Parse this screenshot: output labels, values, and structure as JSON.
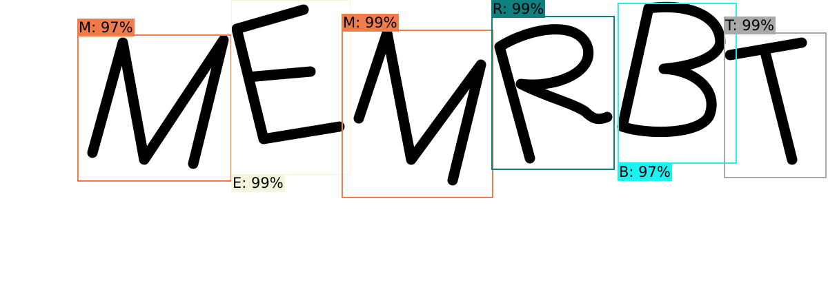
{
  "detections": [
    {
      "id": "m1",
      "letter": "M",
      "label": "M: 97%",
      "color": "#f07c4c",
      "label_text_color": "#000000"
    },
    {
      "id": "e",
      "letter": "E",
      "label": "E: 99%",
      "color": "#f5f5dc",
      "label_text_color": "#000000"
    },
    {
      "id": "m2",
      "letter": "M",
      "label": "M: 99%",
      "color": "#f07c4c",
      "label_text_color": "#000000"
    },
    {
      "id": "r",
      "letter": "R",
      "label": "R: 99%",
      "color": "#0f8080",
      "label_text_color": "#000000"
    },
    {
      "id": "b",
      "letter": "B",
      "label": "B: 97%",
      "color": "#1cf2f2",
      "label_text_color": "#000000"
    },
    {
      "id": "t",
      "letter": "T",
      "label": "T: 99%",
      "color": "#a9a9a9",
      "label_text_color": "#000000"
    }
  ],
  "captcha_text": "MEMRBT",
  "background_color": "#ffffff",
  "glyph_color": "#000000"
}
